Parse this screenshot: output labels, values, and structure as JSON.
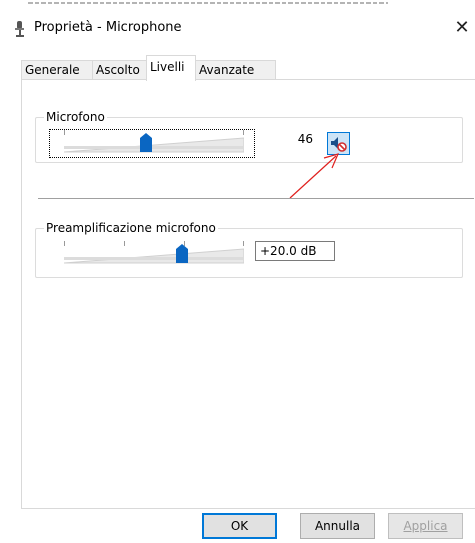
{
  "window": {
    "title": "Proprietà - Microphone",
    "close_glyph": "✕"
  },
  "tabs": [
    {
      "label": "Generale",
      "active": false
    },
    {
      "label": "Ascolto",
      "active": false
    },
    {
      "label": "Livelli",
      "active": true
    },
    {
      "label": "Avanzate",
      "active": false
    }
  ],
  "levels": {
    "microphone": {
      "label": "Microfono",
      "value": "46",
      "level_fraction": 0.46,
      "mute_icon": "speaker-muted-icon"
    },
    "boost": {
      "label": "Preamplificazione microfono",
      "value": "+20.0 dB",
      "level_fraction": 0.67
    }
  },
  "annotation": {
    "color": "#e0201e",
    "icon": "red-arrow-annotation"
  },
  "buttons": {
    "ok": "OK",
    "cancel": "Annulla",
    "apply": "Applica"
  },
  "colors": {
    "accent": "#0078d7",
    "thumb": "#0a66c2",
    "mute_bg": "#cce4f7"
  }
}
